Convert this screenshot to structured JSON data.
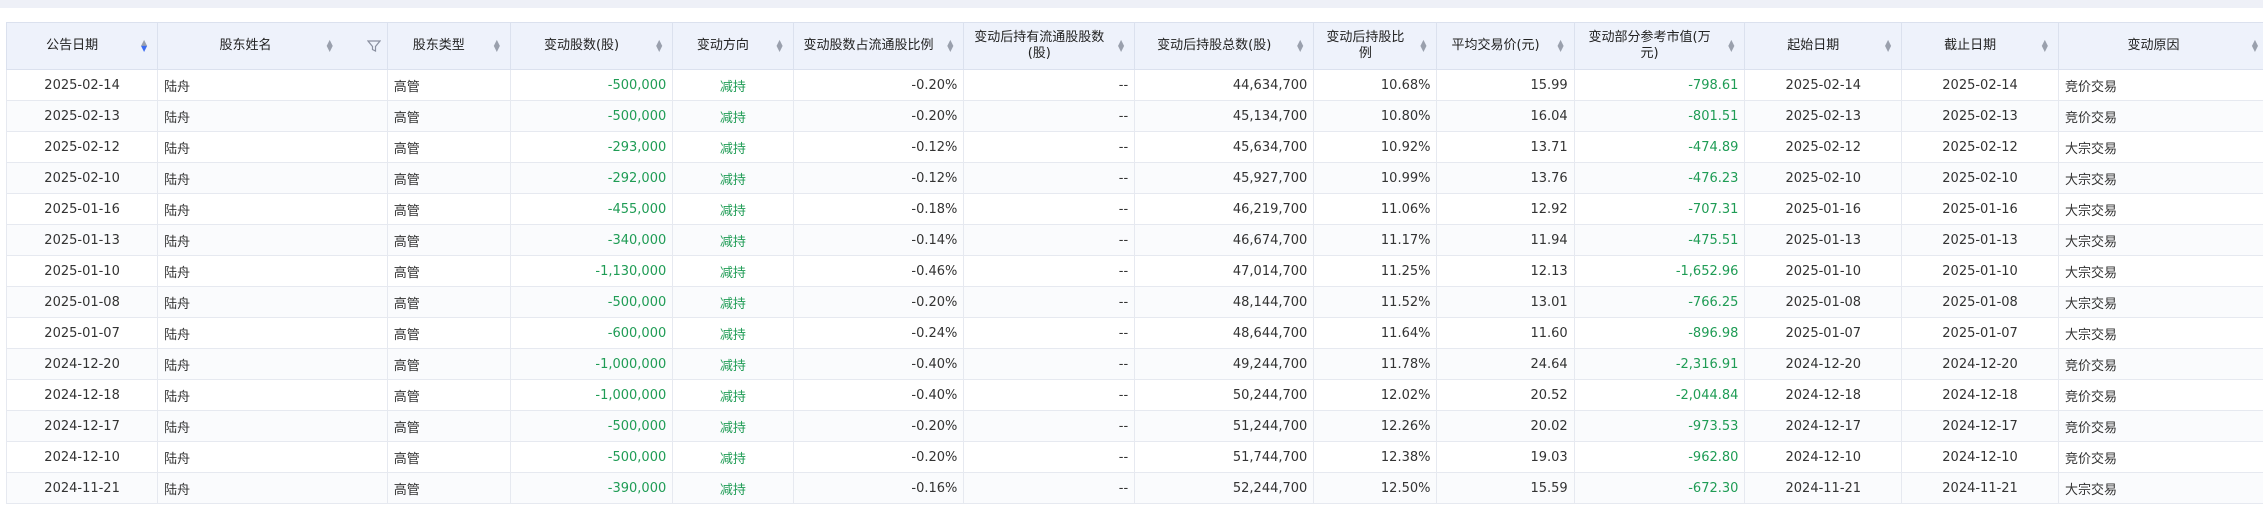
{
  "columns": [
    {
      "key": "date",
      "label": "公告日期"
    },
    {
      "key": "name",
      "label": "股东姓名"
    },
    {
      "key": "type",
      "label": "股东类型"
    },
    {
      "key": "shares",
      "label": "变动股数(股)"
    },
    {
      "key": "dir",
      "label": "变动方向"
    },
    {
      "key": "pct",
      "label": "变动股数占流通股比例"
    },
    {
      "key": "float",
      "label": "变动后持有流通股股数(股)"
    },
    {
      "key": "total",
      "label": "变动后持股总数(股)"
    },
    {
      "key": "ratio",
      "label": "变动后持股比例"
    },
    {
      "key": "avg",
      "label": "平均交易价(元)"
    },
    {
      "key": "value",
      "label": "变动部分参考市值(万元)"
    },
    {
      "key": "start",
      "label": "起始日期"
    },
    {
      "key": "end",
      "label": "截止日期"
    },
    {
      "key": "reason",
      "label": "变动原因"
    }
  ],
  "rows": [
    {
      "date": "2025-02-14",
      "name": "陆舟",
      "type": "高管",
      "shares": "-500,000",
      "dir": "减持",
      "pct": "-0.20%",
      "float": "--",
      "total": "44,634,700",
      "ratio": "10.68%",
      "avg": "15.99",
      "value": "-798.61",
      "start": "2025-02-14",
      "end": "2025-02-14",
      "reason": "竞价交易"
    },
    {
      "date": "2025-02-13",
      "name": "陆舟",
      "type": "高管",
      "shares": "-500,000",
      "dir": "减持",
      "pct": "-0.20%",
      "float": "--",
      "total": "45,134,700",
      "ratio": "10.80%",
      "avg": "16.04",
      "value": "-801.51",
      "start": "2025-02-13",
      "end": "2025-02-13",
      "reason": "竞价交易"
    },
    {
      "date": "2025-02-12",
      "name": "陆舟",
      "type": "高管",
      "shares": "-293,000",
      "dir": "减持",
      "pct": "-0.12%",
      "float": "--",
      "total": "45,634,700",
      "ratio": "10.92%",
      "avg": "13.71",
      "value": "-474.89",
      "start": "2025-02-12",
      "end": "2025-02-12",
      "reason": "大宗交易"
    },
    {
      "date": "2025-02-10",
      "name": "陆舟",
      "type": "高管",
      "shares": "-292,000",
      "dir": "减持",
      "pct": "-0.12%",
      "float": "--",
      "total": "45,927,700",
      "ratio": "10.99%",
      "avg": "13.76",
      "value": "-476.23",
      "start": "2025-02-10",
      "end": "2025-02-10",
      "reason": "大宗交易"
    },
    {
      "date": "2025-01-16",
      "name": "陆舟",
      "type": "高管",
      "shares": "-455,000",
      "dir": "减持",
      "pct": "-0.18%",
      "float": "--",
      "total": "46,219,700",
      "ratio": "11.06%",
      "avg": "12.92",
      "value": "-707.31",
      "start": "2025-01-16",
      "end": "2025-01-16",
      "reason": "大宗交易"
    },
    {
      "date": "2025-01-13",
      "name": "陆舟",
      "type": "高管",
      "shares": "-340,000",
      "dir": "减持",
      "pct": "-0.14%",
      "float": "--",
      "total": "46,674,700",
      "ratio": "11.17%",
      "avg": "11.94",
      "value": "-475.51",
      "start": "2025-01-13",
      "end": "2025-01-13",
      "reason": "大宗交易"
    },
    {
      "date": "2025-01-10",
      "name": "陆舟",
      "type": "高管",
      "shares": "-1,130,000",
      "dir": "减持",
      "pct": "-0.46%",
      "float": "--",
      "total": "47,014,700",
      "ratio": "11.25%",
      "avg": "12.13",
      "value": "-1,652.96",
      "start": "2025-01-10",
      "end": "2025-01-10",
      "reason": "大宗交易"
    },
    {
      "date": "2025-01-08",
      "name": "陆舟",
      "type": "高管",
      "shares": "-500,000",
      "dir": "减持",
      "pct": "-0.20%",
      "float": "--",
      "total": "48,144,700",
      "ratio": "11.52%",
      "avg": "13.01",
      "value": "-766.25",
      "start": "2025-01-08",
      "end": "2025-01-08",
      "reason": "大宗交易"
    },
    {
      "date": "2025-01-07",
      "name": "陆舟",
      "type": "高管",
      "shares": "-600,000",
      "dir": "减持",
      "pct": "-0.24%",
      "float": "--",
      "total": "48,644,700",
      "ratio": "11.64%",
      "avg": "11.60",
      "value": "-896.98",
      "start": "2025-01-07",
      "end": "2025-01-07",
      "reason": "大宗交易"
    },
    {
      "date": "2024-12-20",
      "name": "陆舟",
      "type": "高管",
      "shares": "-1,000,000",
      "dir": "减持",
      "pct": "-0.40%",
      "float": "--",
      "total": "49,244,700",
      "ratio": "11.78%",
      "avg": "24.64",
      "value": "-2,316.91",
      "start": "2024-12-20",
      "end": "2024-12-20",
      "reason": "竞价交易"
    },
    {
      "date": "2024-12-18",
      "name": "陆舟",
      "type": "高管",
      "shares": "-1,000,000",
      "dir": "减持",
      "pct": "-0.40%",
      "float": "--",
      "total": "50,244,700",
      "ratio": "12.02%",
      "avg": "20.52",
      "value": "-2,044.84",
      "start": "2024-12-18",
      "end": "2024-12-18",
      "reason": "竞价交易"
    },
    {
      "date": "2024-12-17",
      "name": "陆舟",
      "type": "高管",
      "shares": "-500,000",
      "dir": "减持",
      "pct": "-0.20%",
      "float": "--",
      "total": "51,244,700",
      "ratio": "12.26%",
      "avg": "20.02",
      "value": "-973.53",
      "start": "2024-12-17",
      "end": "2024-12-17",
      "reason": "竞价交易"
    },
    {
      "date": "2024-12-10",
      "name": "陆舟",
      "type": "高管",
      "shares": "-500,000",
      "dir": "减持",
      "pct": "-0.20%",
      "float": "--",
      "total": "51,744,700",
      "ratio": "12.38%",
      "avg": "19.03",
      "value": "-962.80",
      "start": "2024-12-10",
      "end": "2024-12-10",
      "reason": "竞价交易"
    },
    {
      "date": "2024-11-21",
      "name": "陆舟",
      "type": "高管",
      "shares": "-390,000",
      "dir": "减持",
      "pct": "-0.16%",
      "float": "--",
      "total": "52,244,700",
      "ratio": "12.50%",
      "avg": "15.59",
      "value": "-672.30",
      "start": "2024-11-21",
      "end": "2024-11-21",
      "reason": "大宗交易"
    }
  ],
  "colors": {
    "negative": "#1f9c55",
    "header_bg": "#eef2fb",
    "sort_active": "#3d6cf0"
  },
  "icons": {
    "sort": "sort-caret-icon",
    "filter": "filter-icon"
  }
}
